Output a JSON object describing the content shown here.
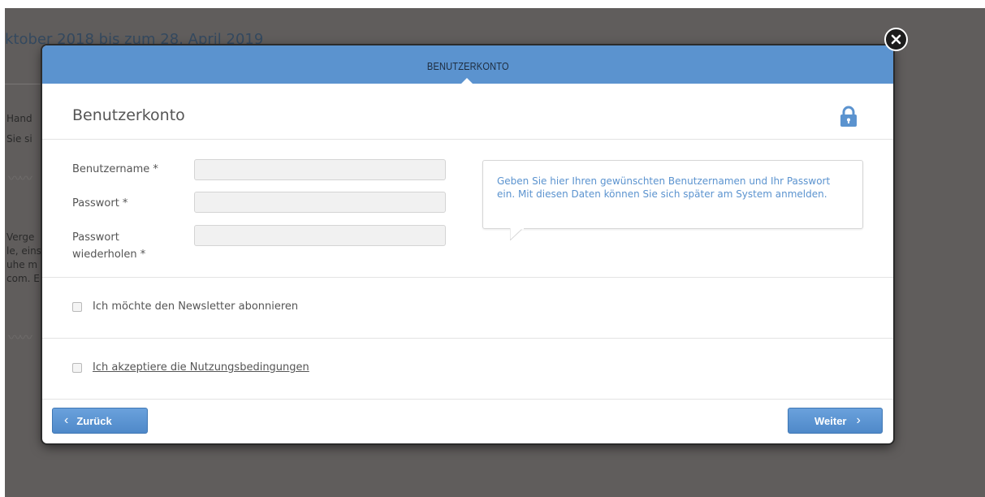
{
  "background": {
    "heading": "ktober 2018 bis zum 28. April 2019",
    "fragments": [
      "Hand",
      "Sie si",
      "Verge",
      "le, eins",
      "uhe m",
      "com. E"
    ]
  },
  "modal": {
    "header_title": "BENUTZERKONTO",
    "section_title": "Benutzerkonto",
    "fields": {
      "username_label": "Benutzername *",
      "password_label": "Passwort *",
      "password_repeat_label_line1": "Passwort",
      "password_repeat_label_line2": "wiederholen *"
    },
    "tooltip": "Geben Sie hier Ihren gewünschten Benutzernamen und Ihr Passwort ein. Mit diesen Daten können Sie sich später am System anmelden.",
    "newsletter_label": "Ich möchte den Newsletter abonnieren",
    "terms_label": "Ich akzeptiere die Nutzungsbedingungen",
    "back_label": "Zurück",
    "next_label": "Weiter"
  },
  "colors": {
    "accent": "#5b93cf",
    "overlay": "#605d5c"
  },
  "icons": {
    "lock": "lock-icon",
    "close": "close-icon",
    "back": "chevron-left-icon",
    "next": "chevron-right-icon"
  }
}
